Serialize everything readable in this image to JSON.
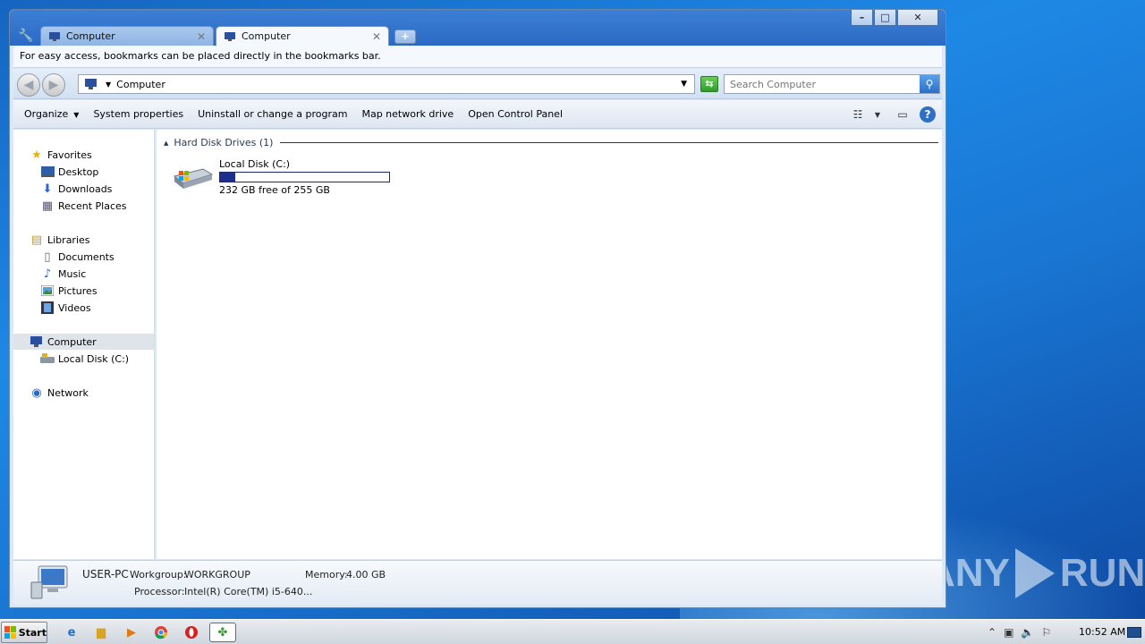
{
  "browser": {
    "tabs": [
      {
        "title": "Computer",
        "active": false
      },
      {
        "title": "Computer",
        "active": true
      }
    ],
    "new_tab_label": "+",
    "bookmark_bar_text": "For easy access, bookmarks can be placed directly in the bookmarks bar."
  },
  "window_controls": {
    "minimize": "–",
    "maximize": "□",
    "close": "✕"
  },
  "address": {
    "back": "◀",
    "forward": "▶",
    "breadcrumb": "Computer",
    "search_placeholder": "Search Computer"
  },
  "toolbar": {
    "organize": "Organize",
    "system_properties": "System properties",
    "uninstall": "Uninstall or change a program",
    "map_drive": "Map network drive",
    "control_panel": "Open Control Panel",
    "help": "?"
  },
  "nav": {
    "favorites": "Favorites",
    "desktop": "Desktop",
    "downloads": "Downloads",
    "recent": "Recent Places",
    "libraries": "Libraries",
    "documents": "Documents",
    "music": "Music",
    "pictures": "Pictures",
    "videos": "Videos",
    "computer": "Computer",
    "local_disk": "Local Disk (C:)",
    "network": "Network"
  },
  "content": {
    "group_title": "Hard Disk Drives (1)",
    "drive": {
      "name": "Local Disk (C:)",
      "space": "232 GB free of 255 GB",
      "used_fraction": 0.09
    }
  },
  "details": {
    "computer_name": "USER-PC",
    "workgroup_label": "Workgroup:",
    "workgroup": "WORKGROUP",
    "memory_label": "Memory:",
    "memory": "4.00 GB",
    "processor_label": "Processor:",
    "processor": "Intel(R) Core(TM) i5-640..."
  },
  "taskbar": {
    "start": "Start",
    "clock": "10:52 AM"
  },
  "watermark": {
    "left": "ANY",
    "right": "RUN"
  }
}
